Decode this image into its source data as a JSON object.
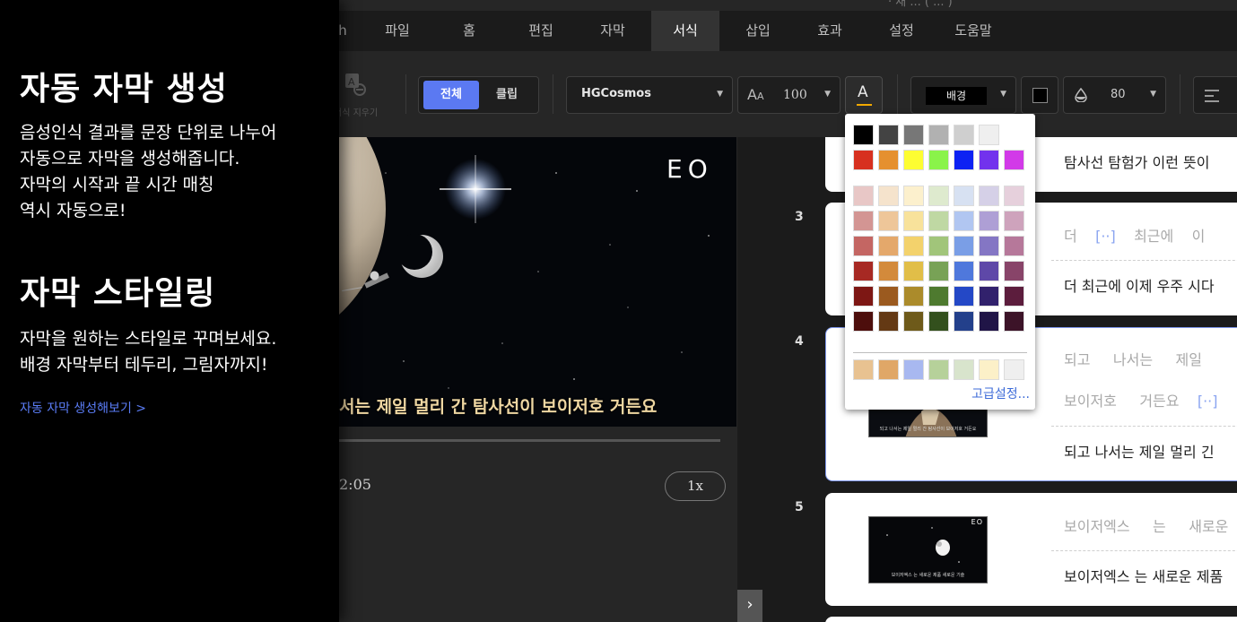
{
  "window": {
    "title_partial": "· 새 ... ( ... )"
  },
  "menu": {
    "items": [
      "파일",
      "홈",
      "편집",
      "자막",
      "서식",
      "삽입",
      "효과",
      "설정",
      "도움말"
    ],
    "first_partial": "h",
    "active": "서식"
  },
  "toolbar": {
    "erase_label": "서식 지우기",
    "scope_all": "전체",
    "scope_clip": "클립",
    "font": "HGCosmos",
    "font_size": "100",
    "font_color_icon": "A",
    "bg_label": "배경",
    "opacity": "80",
    "accent_color": "#5b79f2",
    "font_color_bar": "#f2a900"
  },
  "video": {
    "logo": "EO",
    "subtitle": "서는 제일 멀리 간 탐사선이 보이저호 거든요",
    "time": "2:05",
    "speed": "1x"
  },
  "subtitle_list": {
    "rows": [
      {
        "num": "",
        "sentence": "탐사선 탐험가 이런 뜻이"
      },
      {
        "num": "3",
        "segments": [
          "더",
          "[··]",
          "최근에",
          "이"
        ],
        "sentence": "더 최근에 이제 우주 시다"
      },
      {
        "num": "4",
        "thumb_caption": "되고 나서는 제일 멀리 간 탐사선이 보이저호 거든요",
        "segments_line1": [
          "되고",
          "나서는",
          "제일"
        ],
        "segments_line2": [
          "보이저호",
          "거든요",
          "[··]"
        ],
        "sentence": "되고 나서는 제일 멀리 긴"
      },
      {
        "num": "5",
        "thumb_logo": "EO",
        "thumb_caption": "보이저엑스 는 새로운 제품 새로운 기술",
        "segments": [
          "보이저엑스",
          "는",
          "새로운"
        ],
        "sentence": "보이저엑스 는 새로운 제품"
      }
    ]
  },
  "color_picker": {
    "basic_row1": [
      "#000000",
      "#434343",
      "#777777",
      "#b1b1b1",
      "#cfcfcf",
      "#efefef",
      "#ffffff"
    ],
    "basic_row2": [
      "#d7301f",
      "#e5902f",
      "#fdfd32",
      "#8af34a",
      "#0d22f3",
      "#7232ed",
      "#d23ae8"
    ],
    "tints": [
      [
        "#e8c7c6",
        "#f5e3cc",
        "#fcf0cd",
        "#deeace",
        "#d7e1f2",
        "#d5d0e7",
        "#e6d0dc"
      ],
      [
        "#d39593",
        "#eec699",
        "#f8e29b",
        "#bfd8a3",
        "#b1c6f1",
        "#ae9fd5",
        "#cea3bc"
      ],
      [
        "#c46663",
        "#e4a86b",
        "#f3d26c",
        "#a1c57a",
        "#7a9ee6",
        "#8476c4",
        "#b6789a"
      ],
      [
        "#a72923",
        "#d38a3b",
        "#e1be48",
        "#78a256",
        "#4f78dc",
        "#5e48a8",
        "#884469"
      ],
      [
        "#7d1714",
        "#9b5a1f",
        "#ab8b2b",
        "#4e7a2f",
        "#2448c6",
        "#31216c",
        "#5c1d3d"
      ],
      [
        "#4d0e0c",
        "#643914",
        "#6e5a1a",
        "#33501d",
        "#23408b",
        "#201547",
        "#3c1328"
      ]
    ],
    "recent": [
      "#e8c291",
      "#e0a767",
      "#a8b8f0",
      "#b6d19a",
      "#d8e4cc",
      "#fcf0c8",
      "#efefef"
    ],
    "advanced_link": "고급설정..."
  },
  "promo": {
    "heading1": "자동 자막 생성",
    "body1": "음성인식 결과를 문장 단위로 나누어\n자동으로 자막을 생성해줍니다.\n자막의 시작과 끝 시간 매칭\n역시 자동으로!",
    "heading2": "자막 스타일링",
    "body2": "자막을 원하는 스타일로 꾸며보세요.\n배경 자막부터 테두리, 그림자까지!",
    "link": "자동 자막 생성해보기 >"
  }
}
